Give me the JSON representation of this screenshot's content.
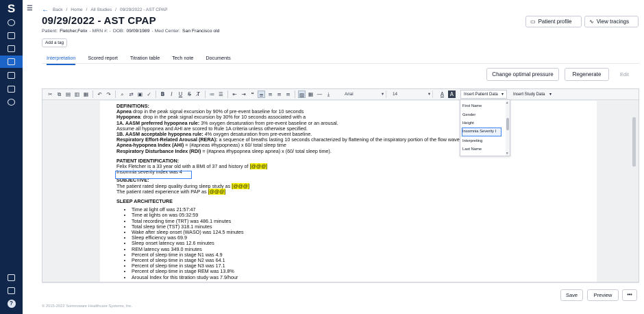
{
  "nav": {
    "logo": "S",
    "items": [
      "users-icon",
      "inbox-icon",
      "calendar-icon",
      "studies-icon",
      "devices-icon",
      "reports-icon",
      "settings-icon"
    ],
    "bottom": [
      "document-icon",
      "sync-icon",
      "help-icon"
    ],
    "help_glyph": "?"
  },
  "breadcrumb": {
    "back": "Back",
    "home": "Home",
    "studies": "All Studies",
    "current": "09/29/2022 - AST CPAP"
  },
  "header": {
    "title": "09/29/2022 - AST CPAP",
    "patient_label": "Patient:",
    "patient_name": "Fletcher,Felix",
    "mrn_label": "- MRN #: -",
    "dob_label": "DOB:",
    "dob": "09/09/1989",
    "center_label": "- Med Center:",
    "center": "San Francisco old",
    "add_tag": "Add a tag",
    "patient_profile": "Patient profile",
    "view_tracings": "View tracings"
  },
  "tabs": [
    "Interpretation",
    "Scored report",
    "Titration table",
    "Tech note",
    "Documents"
  ],
  "actions": {
    "change_pressure": "Change optimal pressure",
    "regenerate": "Regenerate",
    "edit": "Edit"
  },
  "toolbar": {
    "font": "Arial",
    "size": "14",
    "insert_patient": "Insert Patient Data",
    "insert_study": "Insert Study Data"
  },
  "dropdown": {
    "items": [
      "First Name",
      "Gender",
      "Height",
      "Insomnia Severity I",
      "Interpreting",
      "Last Name"
    ]
  },
  "document": {
    "definitions": {
      "heading": "DEFINITIONS:",
      "apnea_label": "Apnea",
      "apnea": " drop in the peak signal excursion by 90% of pre-event baseline for 10 seconds",
      "hypopnea_label": "Hypopnea",
      "hypopnea": ": drop in the peak signal excursion by 30% for 10 seconds associated with a",
      "aasm1_label": "1A. AASM preferred hypopnea rule:",
      "aasm1": " 3% oxygen desaturation from pre-event baseline or an arousal.",
      "assume": "Assume all hypopnea and AHI are scored to Rule 1A criteria unless otherwise specified.",
      "aasm2_label": "1B. AASM acceptable hypopnea rule:",
      "aasm2": " 4% oxygen desaturation from pre-event baseline.",
      "rera_label": "Respiratory Effort-Related Arousal (RERA):",
      "rera": " a sequence of breaths lasting 10 seconds characterized by flattening of the inspiratory portion of the flow waveform le",
      "ahi_label": "Apnea-hypopnea Index (AHI)",
      "ahi": " = (#apneas #hypopneas) x 60/ total sleep time",
      "rdi_label": "Respiratory Disturbance Index (RDI)",
      "rdi": " = (#apnea #hypopnea sleep apnea) x (60/ total sleep time)."
    },
    "patient_id": {
      "heading": "PATIENT IDENTIFICATION:",
      "line": "Felix Fletcher is a 33 year old with a BMI of 37 and history of ",
      "placeholder": "[@@@]",
      "insomnia": "Insomnia severity index was 4"
    },
    "subjective": {
      "heading": "SUBJECTIVE:",
      "line1": "The patient rated sleep quality during sleep study as ",
      "line2": "The patient rated experience with PAP as ",
      "placeholder": "[@@@]"
    },
    "architecture": {
      "heading": "SLEEP ARCHITECTURE",
      "items": [
        "Time at light off was 21:57:47",
        "Time at lights on was 05:32:59",
        "Total recording time (TRT) was 486.1 minutes",
        "Total sleep time (TST) 318.1 minutes",
        "Wake after sleep onset (WASO) was 124.5 minutes",
        "Sleep efficiency was 69.9",
        "Sleep onset latency was 12.6 minutes",
        "REM latency was 349.0 minutes",
        "Percent of sleep time in stage N1 was 4.9",
        "Percent of sleep time in stage N2 was 64.1",
        "Percent of sleep time in stage N3 was 17.1",
        "Percent of sleep time in stage REM was 13.8%",
        "Arousal Index for this titration study was 7.9/hour"
      ]
    }
  },
  "footer": {
    "copyright": "© 2015-2022 Somnoware Healthcare Systems, Inc.",
    "save": "Save",
    "preview": "Preview",
    "more": "•••"
  }
}
